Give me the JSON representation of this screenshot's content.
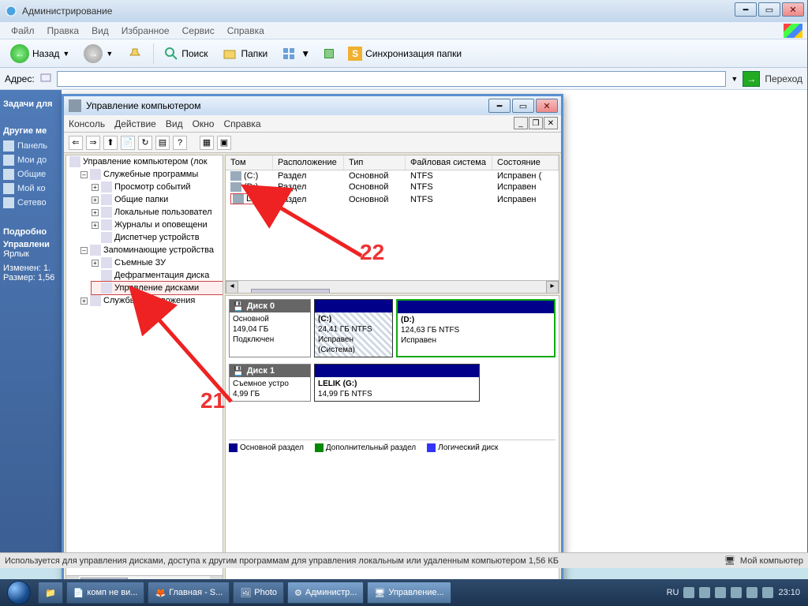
{
  "outer": {
    "title": "Администрирование",
    "menu": {
      "file": "Файл",
      "edit": "Правка",
      "view": "Вид",
      "fav": "Избранное",
      "tools": "Сервис",
      "help": "Справка"
    },
    "toolbar": {
      "back": "Назад",
      "search": "Поиск",
      "folders": "Папки",
      "sync": "Синхронизация папки"
    },
    "address": {
      "label": "Адрес:",
      "go": "Переход"
    }
  },
  "sidebar": {
    "hdr1": "Задачи для",
    "hdr2": "Другие ме",
    "items": [
      "Панель",
      "Мои до",
      "Общие",
      "Мой ко",
      "Сетево"
    ],
    "hdr3": "Подробно",
    "details_title": "Управлени",
    "details_l1": "Ярлык",
    "details_l2": "Изменен: 1.",
    "details_l3": "Размер: 1,56"
  },
  "mmc": {
    "title": "Управление компьютером",
    "menu": {
      "console": "Консоль",
      "action": "Действие",
      "view": "Вид",
      "window": "Окно",
      "help": "Справка"
    },
    "tree": {
      "root": "Управление компьютером (лок",
      "grp1": "Служебные программы",
      "t1": "Просмотр событий",
      "t2": "Общие папки",
      "t3": "Локальные пользовател",
      "t4": "Журналы и оповещени",
      "t5": "Диспетчер устройств",
      "grp2": "Запоминающие устройства",
      "t6": "Съемные ЗУ",
      "t7": "Дефрагментация диска",
      "t8": "Управление дисками",
      "grp3": "Службы и приложения"
    },
    "vol": {
      "cols": {
        "vol": "Том",
        "loc": "Расположение",
        "type": "Тип",
        "fs": "Файловая система",
        "state": "Состояние"
      },
      "rows": [
        {
          "v": "(C:)",
          "loc": "Раздел",
          "type": "Основной",
          "fs": "NTFS",
          "st": "Исправен ("
        },
        {
          "v": "(D:)",
          "loc": "Раздел",
          "type": "Основной",
          "fs": "NTFS",
          "st": "Исправен"
        },
        {
          "v": "LELIK",
          "loc": "Раздел",
          "type": "Основной",
          "fs": "NTFS",
          "st": "Исправен"
        }
      ]
    },
    "disks": {
      "d0": {
        "name": "Диск 0",
        "kind": "Основной",
        "size": "149,04 ГБ",
        "state": "Подключен",
        "p1": {
          "label": "(C:)",
          "size": "24,41 ГБ NTFS",
          "st": "Исправен (Система)"
        },
        "p2": {
          "label": "(D:)",
          "size": "124,63 ГБ NTFS",
          "st": "Исправен"
        }
      },
      "d1": {
        "name": "Диск 1",
        "kind": "Съемное устро",
        "size": "4,99 ГБ",
        "p1": {
          "label": "LELIK  (G:)",
          "size": "14,99 ГБ NTFS"
        }
      }
    },
    "legend": {
      "l1": "Основной раздел",
      "l2": "Дополнительный раздел",
      "l3": "Логический диск"
    }
  },
  "annotations": {
    "a21": "21",
    "a22": "22"
  },
  "status": {
    "text": "Используется для управления дисками, доступа к другим программам для управления локальным или удаленным компьютером 1,56 КБ",
    "right": "Мой компьютер"
  },
  "taskbar": {
    "tasks": [
      {
        "label": "комп не ви..."
      },
      {
        "label": "Главная - S..."
      },
      {
        "label": "Photo"
      },
      {
        "label": "Администр..."
      },
      {
        "label": "Управление..."
      }
    ],
    "lang": "RU",
    "time": "23:10"
  }
}
